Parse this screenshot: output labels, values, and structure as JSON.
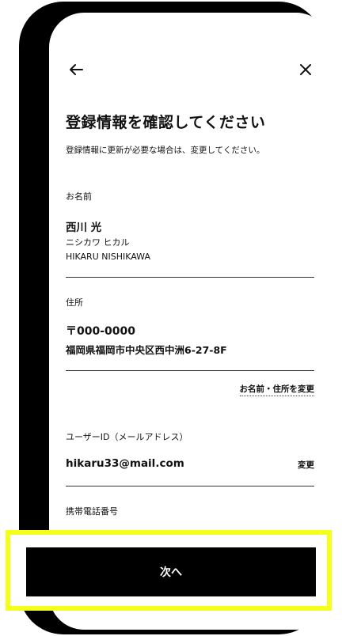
{
  "header": {
    "back_icon": "arrow-left-icon",
    "close_icon": "close-icon"
  },
  "page": {
    "title": "登録情報を確認してください",
    "subtitle": "登録情報に更新が必要な場合は、変更してください。"
  },
  "name_section": {
    "label": "お名前",
    "kanji": "西川 光",
    "katakana": "ニシカワ ヒカル",
    "romaji": "HIKARU NISHIKAWA"
  },
  "address_section": {
    "label": "住所",
    "postal": "〒000-0000",
    "address": "福岡県福岡市中央区西中洲6-27-8F",
    "change_link": "お名前・住所を変更"
  },
  "user_id_section": {
    "label": "ユーザーID（メールアドレス）",
    "email": "hikaru33@mail.com",
    "change_link": "変更"
  },
  "phone_section": {
    "label": "携帯電話番号"
  },
  "cta": {
    "next_label": "次へ"
  },
  "colors": {
    "frame": "#000000",
    "highlight": "#f4ff1c",
    "button_bg": "#000000",
    "button_text": "#ffffff"
  }
}
